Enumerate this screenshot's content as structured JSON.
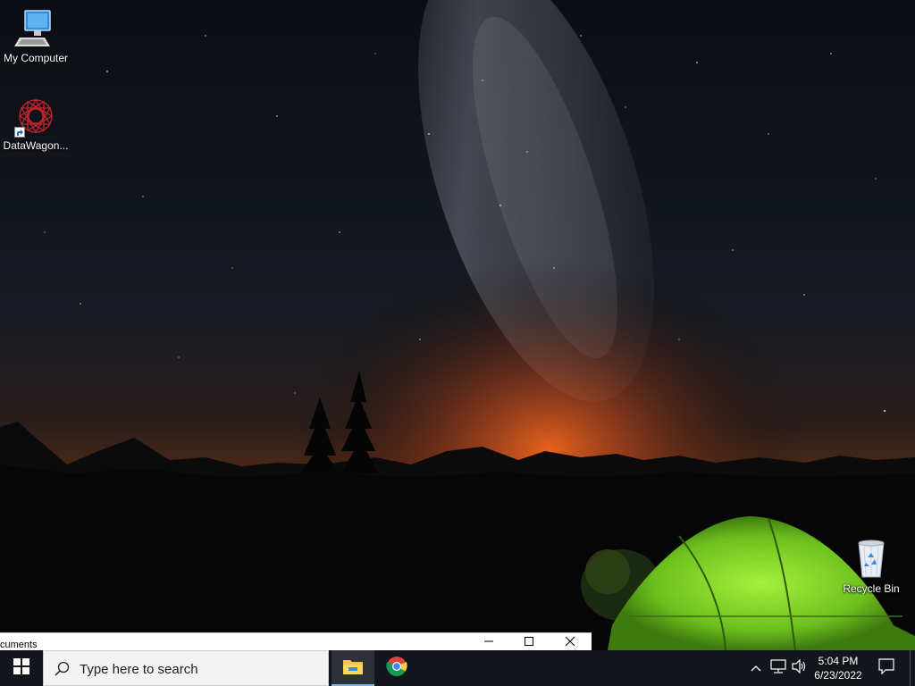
{
  "desktop": {
    "icons": [
      {
        "label": "My Computer",
        "icon": "computer-icon"
      },
      {
        "label": "DataWagon...",
        "icon": "datawagon-icon"
      },
      {
        "label": "Recycle Bin",
        "icon": "recycle-bin-icon"
      }
    ]
  },
  "window": {
    "title": "cuments"
  },
  "taskbar": {
    "search_placeholder": "Type here to search",
    "apps": [
      {
        "name": "File Explorer",
        "icon": "folder-icon",
        "active": true
      },
      {
        "name": "Google Chrome",
        "icon": "chrome-icon",
        "active": false
      }
    ],
    "tray": {
      "time": "5:04 PM",
      "date": "6/23/2022"
    }
  },
  "colors": {
    "taskbar": "#14181e",
    "accent": "#76b9ed",
    "tent": "#7fd42a",
    "glow": "#d9531a"
  }
}
